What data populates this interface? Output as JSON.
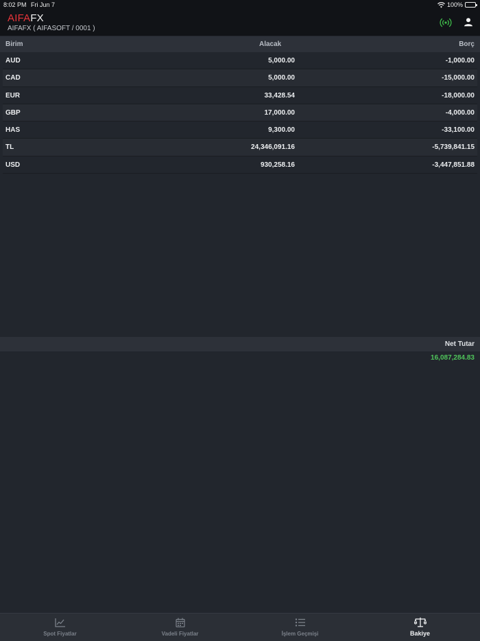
{
  "status_bar": {
    "time": "8:02 PM",
    "date": "Fri Jun 7",
    "battery": "100%"
  },
  "app": {
    "brand_part1": "AIFA",
    "brand_part2": "FX",
    "subtitle": "AIFAFX  ( AIFASOFT / 0001 )",
    "brand_color": "#e9343a",
    "icons": {
      "signal": "broadcast-signal-icon",
      "user": "user-icon"
    }
  },
  "table": {
    "headers": {
      "unit": "Birim",
      "credit": "Alacak",
      "debit": "Borç"
    },
    "rows": [
      {
        "unit": "AUD",
        "credit": "5,000.00",
        "debit": "-1,000.00"
      },
      {
        "unit": "CAD",
        "credit": "5,000.00",
        "debit": "-15,000.00"
      },
      {
        "unit": "EUR",
        "credit": "33,428.54",
        "debit": "-18,000.00"
      },
      {
        "unit": "GBP",
        "credit": "17,000.00",
        "debit": "-4,000.00"
      },
      {
        "unit": "HAS",
        "credit": "9,300.00",
        "debit": "-33,100.00"
      },
      {
        "unit": "TL",
        "credit": "24,346,091.16",
        "debit": "-5,739,841.15"
      },
      {
        "unit": "USD",
        "credit": "930,258.16",
        "debit": "-3,447,851.88"
      }
    ]
  },
  "net": {
    "label": "Net Tutar",
    "value": "16,087,284.83",
    "value_color": "#4fc35a"
  },
  "tabs": [
    {
      "label": "Spot Fiyatlar",
      "icon": "line-chart-icon",
      "active": false
    },
    {
      "label": "Vadeli Fiyatlar",
      "icon": "calendar-icon",
      "active": false
    },
    {
      "label": "İşlem Geçmişi",
      "icon": "list-icon",
      "active": false
    },
    {
      "label": "Bakiye",
      "icon": "scale-icon",
      "active": true
    }
  ]
}
